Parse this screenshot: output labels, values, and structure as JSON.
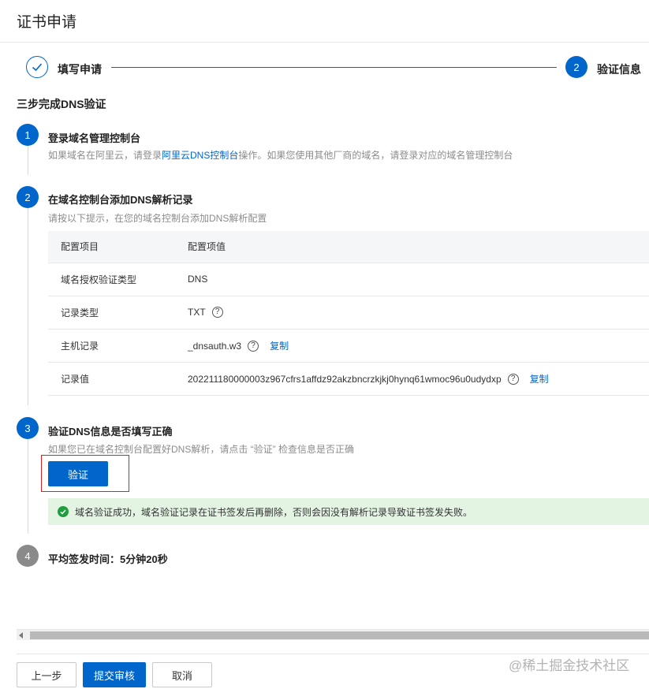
{
  "page": {
    "title": "证书申请"
  },
  "stepper": {
    "step1": {
      "label": "填写申请",
      "status": "done"
    },
    "step2": {
      "number": "2",
      "label": "验证信息",
      "status": "active"
    }
  },
  "section_title": "三步完成DNS验证",
  "steps": [
    {
      "number": "1",
      "title": "登录域名管理控制台",
      "desc_prefix": "如果域名在阿里云，请登录",
      "desc_link": "阿里云DNS控制台",
      "desc_suffix": "操作。如果您使用其他厂商的域名，请登录对应的域名管理控制台"
    },
    {
      "number": "2",
      "title": "在域名控制台添加DNS解析记录",
      "desc": "请按以下提示，在您的域名控制台添加DNS解析配置"
    },
    {
      "number": "3",
      "title": "验证DNS信息是否填写正确",
      "desc": "如果您已在域名控制台配置好DNS解析，请点击 “验证” 检查信息是否正确"
    },
    {
      "number": "4",
      "title": "平均签发时间：5分钟20秒"
    }
  ],
  "table": {
    "headers": [
      "配置项目",
      "配置项值"
    ],
    "rows": [
      {
        "key": "域名授权验证类型",
        "value": "DNS",
        "help": false,
        "copy": false
      },
      {
        "key": "记录类型",
        "value": "TXT",
        "help": true,
        "copy": false
      },
      {
        "key": "主机记录",
        "value": "_dnsauth.w3",
        "help": true,
        "copy": true
      },
      {
        "key": "记录值",
        "value": "202211180000003z967cfrs1affdz92akzbncrzkjkj0hynq61wmoc96u0udydxp",
        "help": true,
        "copy": true
      }
    ],
    "copy_label": "复制",
    "help_glyph": "?"
  },
  "verify_button": "验证",
  "success_message": "域名验证成功，域名验证记录在证书签发后再删除，否则会因没有解析记录导致证书签发失败。",
  "footer": {
    "prev": "上一步",
    "submit": "提交审核",
    "cancel": "取消"
  },
  "watermark": "@稀土掘金技术社区",
  "colors": {
    "primary": "#0066cc",
    "success": "#1f9e3f",
    "success_bg": "#e3f4e3",
    "highlight_border": "#e02020"
  }
}
